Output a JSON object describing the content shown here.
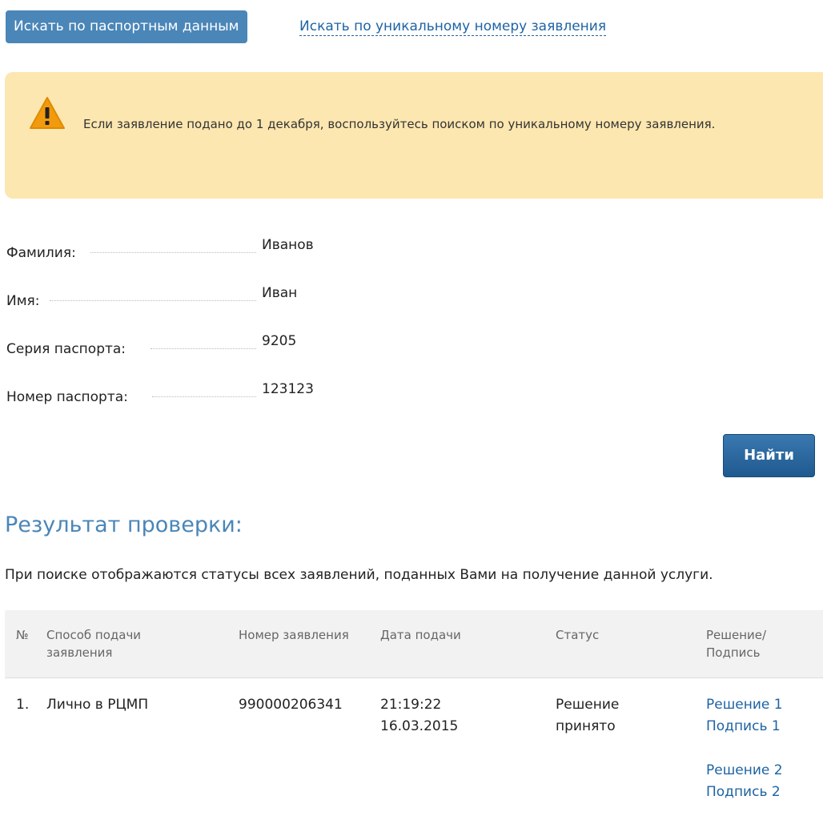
{
  "tabs": {
    "active_label": "Искать по паспортным данным",
    "link_label": "Искать по уникальному номеру заявления"
  },
  "warning": {
    "icon": "warning-triangle-icon",
    "text": "Если заявление подано до 1 декабря, воспользуйтесь поиском по уникальному номеру заявления."
  },
  "form": {
    "last_name_label": "Фамилия:",
    "last_name_value": "Иванов",
    "first_name_label": "Имя:",
    "first_name_value": "Иван",
    "series_label": "Серия паспорта:",
    "series_value": "9205",
    "number_label": "Номер паспорта:",
    "number_value": "123123",
    "find_label": "Найти"
  },
  "results": {
    "title": "Результат проверки:",
    "note": "При поиске отображаются статусы всех заявлений, поданных Вами на получение данной услуги.",
    "headers": {
      "num": "№",
      "method": "Способ подачи заявления",
      "app_number": "Номер заявления",
      "date": "Дата подачи",
      "status": "Статус",
      "decision": "Решение/ Подпись"
    },
    "row": {
      "num": "1.",
      "method": "Лично в РЦМП",
      "app_number": "990000206341",
      "time": "21:19:22",
      "date": "16.03.2015",
      "status_line1": "Решение",
      "status_line2": "принято",
      "decision1": "Решение 1",
      "signature1": "Подпись 1",
      "decision2": "Решение 2",
      "signature2": "Подпись 2"
    }
  },
  "colors": {
    "accent": "#4a86b8",
    "link": "#1e63a3",
    "warning_bg": "#fde7b0",
    "warning_icon": "#f29a0e"
  }
}
